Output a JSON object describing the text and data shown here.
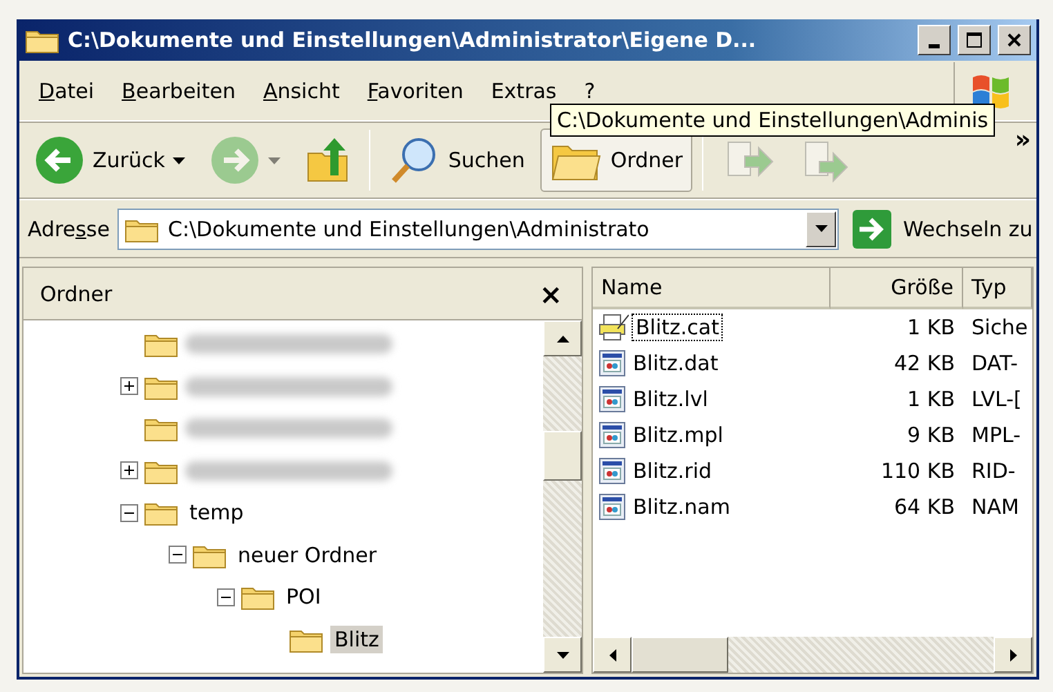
{
  "window": {
    "title": "C:\\Dokumente und Einstellungen\\Administrator\\Eigene D..."
  },
  "menu": [
    {
      "key": "D",
      "post": "atei"
    },
    {
      "key": "B",
      "post": "earbeiten"
    },
    {
      "key": "A",
      "post": "nsicht"
    },
    {
      "key": "F",
      "post": "avoriten"
    },
    {
      "pre": "Extras"
    },
    {
      "pre": "?"
    }
  ],
  "tooltip": "C:\\Dokumente und Einstellungen\\Adminis",
  "toolbar": [
    {
      "kind": "back",
      "label": "Zurück"
    },
    {
      "kind": "forward",
      "disabled": true
    },
    {
      "kind": "up"
    },
    {
      "kind": "separator"
    },
    {
      "kind": "search",
      "label": "Suchen",
      "selected": false
    },
    {
      "kind": "folders",
      "label": "Ordner",
      "selected": true
    },
    {
      "kind": "separator"
    },
    {
      "kind": "move",
      "disabled": true
    },
    {
      "kind": "copy",
      "disabled": true
    }
  ],
  "toolbar_overflow": "»",
  "address": {
    "pre": "Adre",
    "key": "s",
    "post": "se",
    "value": "C:\\Dokumente und Einstellungen\\Administrato",
    "go": "Wechseln zu"
  },
  "folders_pane": {
    "title": "Ordner",
    "close": "×",
    "tree": [
      {
        "kind": "blurred"
      },
      {
        "kind": "blurred",
        "expanded": false
      },
      {
        "kind": "blurred"
      },
      {
        "kind": "blurred",
        "expanded": false
      },
      {
        "label": "temp",
        "expanded": true,
        "selected": false,
        "children": [
          {
            "label": "neuer Ordner",
            "expanded": true,
            "selected": false,
            "children": [
              {
                "label": "POI",
                "expanded": true,
                "selected": false,
                "children": [
                  {
                    "label": "Blitz",
                    "selected": true
                  }
                ]
              }
            ]
          }
        ]
      }
    ]
  },
  "files": {
    "columns": [
      "Name",
      "Größe",
      "Typ"
    ],
    "rows": [
      {
        "kind": "catalog",
        "name": "Blitz.cat",
        "size": "1 KB",
        "type": "Siche",
        "focused": true
      },
      {
        "kind": "app",
        "name": "Blitz.dat",
        "size": "42 KB",
        "type": "DAT-",
        "focused": false
      },
      {
        "kind": "app",
        "name": "Blitz.lvl",
        "size": "1 KB",
        "type": "LVL-[",
        "focused": false
      },
      {
        "kind": "app",
        "name": "Blitz.mpl",
        "size": "9 KB",
        "type": "MPL-",
        "focused": false
      },
      {
        "kind": "app",
        "name": "Blitz.rid",
        "size": "110 KB",
        "type": "RID-",
        "focused": false
      },
      {
        "kind": "app",
        "name": "Blitz.nam",
        "size": "64 KB",
        "type": "NAM",
        "focused": false
      }
    ]
  }
}
